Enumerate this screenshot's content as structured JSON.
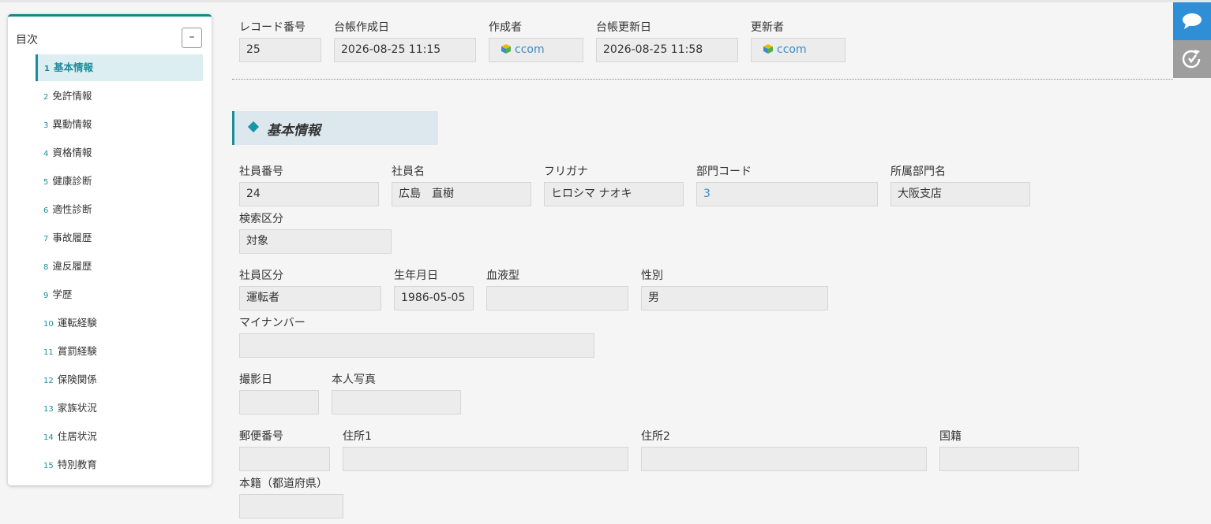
{
  "toc": {
    "title": "目次",
    "collapse_label": "–",
    "items": [
      {
        "num": "1",
        "label": "基本情報"
      },
      {
        "num": "2",
        "label": "免許情報"
      },
      {
        "num": "3",
        "label": "異動情報"
      },
      {
        "num": "4",
        "label": "資格情報"
      },
      {
        "num": "5",
        "label": "健康診断"
      },
      {
        "num": "6",
        "label": "適性診断"
      },
      {
        "num": "7",
        "label": "事故履歴"
      },
      {
        "num": "8",
        "label": "違反履歴"
      },
      {
        "num": "9",
        "label": "学歴"
      },
      {
        "num": "10",
        "label": "運転経験"
      },
      {
        "num": "11",
        "label": "賞罰経験"
      },
      {
        "num": "12",
        "label": "保険関係"
      },
      {
        "num": "13",
        "label": "家族状況"
      },
      {
        "num": "14",
        "label": "住居状況"
      },
      {
        "num": "15",
        "label": "特別教育"
      }
    ]
  },
  "record": {
    "record_no_label": "レコード番号",
    "record_no": "25",
    "created_label": "台帳作成日",
    "created": "2026-08-25 11:15",
    "creator_label": "作成者",
    "creator": "ccom",
    "updated_label": "台帳更新日",
    "updated": "2026-08-25 11:58",
    "updater_label": "更新者",
    "updater": "ccom"
  },
  "section": {
    "title": "基本情報"
  },
  "fields": {
    "emp_no_label": "社員番号",
    "emp_no": "24",
    "emp_name_label": "社員名",
    "emp_name": "広島　直樹",
    "furigana_label": "フリガナ",
    "furigana": "ヒロシマ ナオキ",
    "dept_code_label": "部門コード",
    "dept_code": "3",
    "dept_name_label": "所属部門名",
    "dept_name": "大阪支店",
    "search_label": "検索区分",
    "search": "対象",
    "emp_type_label": "社員区分",
    "emp_type": "運転者",
    "birth_label": "生年月日",
    "birth": "1986-05-05",
    "blood_label": "血液型",
    "blood": "",
    "gender_label": "性別",
    "gender": "男",
    "mynumber_label": "マイナンバー",
    "mynumber": "",
    "photo_date_label": "撮影日",
    "photo_date": "",
    "photo_label": "本人写真",
    "photo": "",
    "zip_label": "郵便番号",
    "zip": "",
    "addr1_label": "住所1",
    "addr1": "",
    "addr2_label": "住所2",
    "addr2": "",
    "nationality_label": "国籍",
    "nationality": "",
    "honseki_label": "本籍（都道府県）",
    "honseki": ""
  },
  "colors": {
    "accent": "#1a8f9c",
    "link": "#3b8cc8",
    "chat": "#2f8fd6",
    "history": "#9e9e9e"
  }
}
